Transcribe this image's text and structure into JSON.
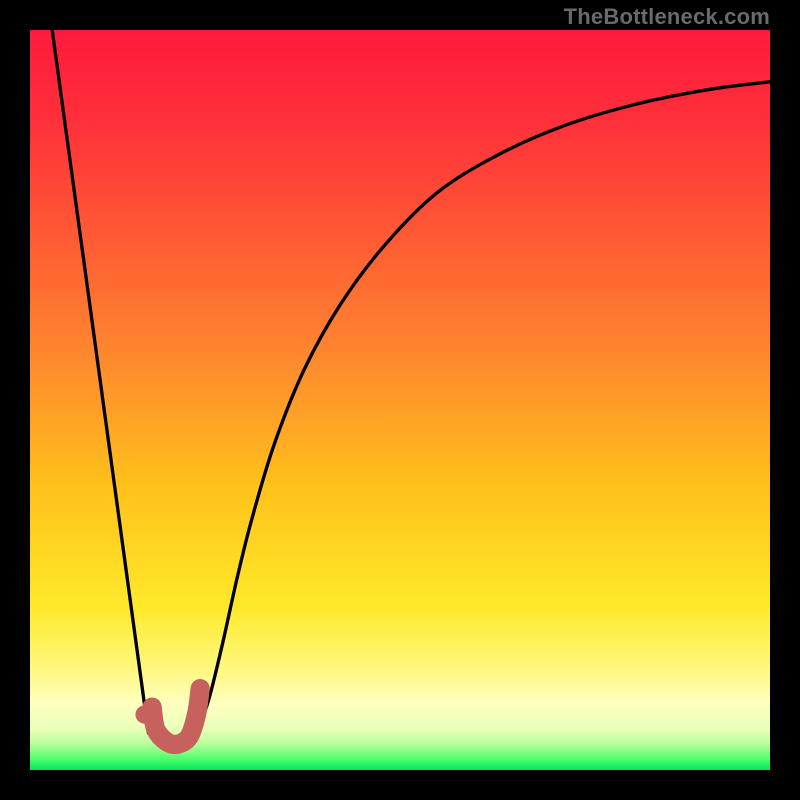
{
  "watermark": {
    "text": "TheBottleneck.com"
  },
  "colors": {
    "frame": "#000000",
    "curve": "#000000",
    "marker_stroke": "#c7615d",
    "marker_fill": "#c7615d",
    "gradient_stops": [
      {
        "offset": 0.0,
        "color": "#ff1a3c"
      },
      {
        "offset": 0.12,
        "color": "#ff2f3a"
      },
      {
        "offset": 0.28,
        "color": "#ff5a34"
      },
      {
        "offset": 0.45,
        "color": "#ff8a2e"
      },
      {
        "offset": 0.62,
        "color": "#ffc21a"
      },
      {
        "offset": 0.78,
        "color": "#ffe92a"
      },
      {
        "offset": 0.86,
        "color": "#fff77a"
      },
      {
        "offset": 0.91,
        "color": "#ffffc0"
      },
      {
        "offset": 0.945,
        "color": "#e8ffb8"
      },
      {
        "offset": 0.965,
        "color": "#b6ff9a"
      },
      {
        "offset": 0.985,
        "color": "#4fff6c"
      },
      {
        "offset": 1.0,
        "color": "#00e85e"
      }
    ]
  },
  "chart_data": {
    "type": "line",
    "title": "",
    "xlabel": "",
    "ylabel": "",
    "xlim": [
      0,
      100
    ],
    "ylim": [
      0,
      100
    ],
    "series": [
      {
        "name": "left-branch",
        "x": [
          3,
          16
        ],
        "y": [
          100,
          5
        ]
      },
      {
        "name": "right-branch",
        "x": [
          22,
          24,
          26,
          28,
          30,
          33,
          37,
          42,
          48,
          55,
          63,
          72,
          82,
          92,
          100
        ],
        "y": [
          4,
          9,
          17,
          26,
          34,
          44,
          54,
          63,
          71,
          78,
          83,
          87,
          90,
          92,
          93
        ]
      }
    ],
    "marker": {
      "name": "J-marker",
      "dot": {
        "x": 15.5,
        "y": 7.5
      },
      "hook": [
        {
          "x": 16.5,
          "y": 8.5
        },
        {
          "x": 17.0,
          "y": 5.5
        },
        {
          "x": 18.5,
          "y": 3.8
        },
        {
          "x": 20.0,
          "y": 3.5
        },
        {
          "x": 21.5,
          "y": 4.5
        },
        {
          "x": 22.5,
          "y": 7.5
        },
        {
          "x": 23.0,
          "y": 11.0
        }
      ]
    }
  }
}
